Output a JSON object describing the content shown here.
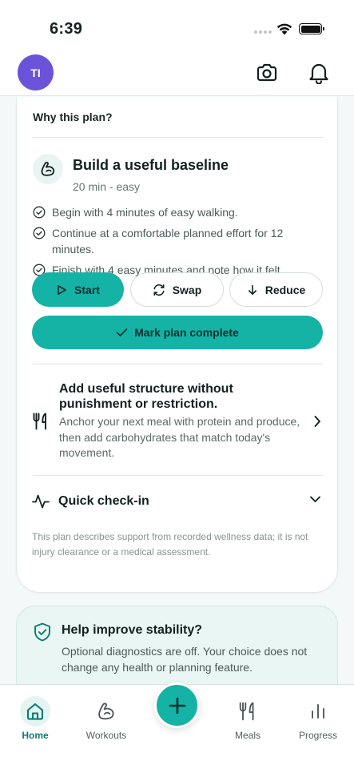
{
  "status_bar": {
    "time": "6:39"
  },
  "header": {
    "avatar_initials": "TI",
    "camera_icon": "camera-icon",
    "bell_icon": "bell-icon"
  },
  "plan": {
    "section_title": "Why this plan?",
    "name": "Build a useful baseline",
    "meta": "20 min - easy",
    "steps": [
      "Begin with 4 minutes of easy walking.",
      "Continue at a comfortable planned effort for 12 minutes.",
      "Finish with 4 easy minutes and note how it felt."
    ],
    "buttons": {
      "start": "Start",
      "swap": "Swap",
      "reduce": "Reduce",
      "complete": "Mark plan complete"
    }
  },
  "nutrition": {
    "title": "Add useful structure without punishment or restriction.",
    "body": "Anchor your next meal with protein and produce, then add carbohydrates that match today's movement."
  },
  "checkin": {
    "label": "Quick check-in"
  },
  "disclaimer": "This plan describes support from recorded wellness data; it is not injury clearance or a medical assessment.",
  "stability": {
    "title": "Help improve stability?",
    "body": "Optional diagnostics are off. Your choice does not change any health or planning feature."
  },
  "tabs": [
    {
      "label": "Home",
      "icon": "home-icon",
      "active": true
    },
    {
      "label": "Workouts",
      "icon": "flex-arm-icon",
      "active": false
    },
    {
      "label": "Meals",
      "icon": "fork-knife-icon",
      "active": false
    },
    {
      "label": "Progress",
      "icon": "bar-chart-icon",
      "active": false
    }
  ],
  "colors": {
    "accent": "#14b3a6",
    "avatar": "#6b53d9",
    "active_tab": "#0e7c72",
    "stability_bg": "#e9f6f3"
  }
}
